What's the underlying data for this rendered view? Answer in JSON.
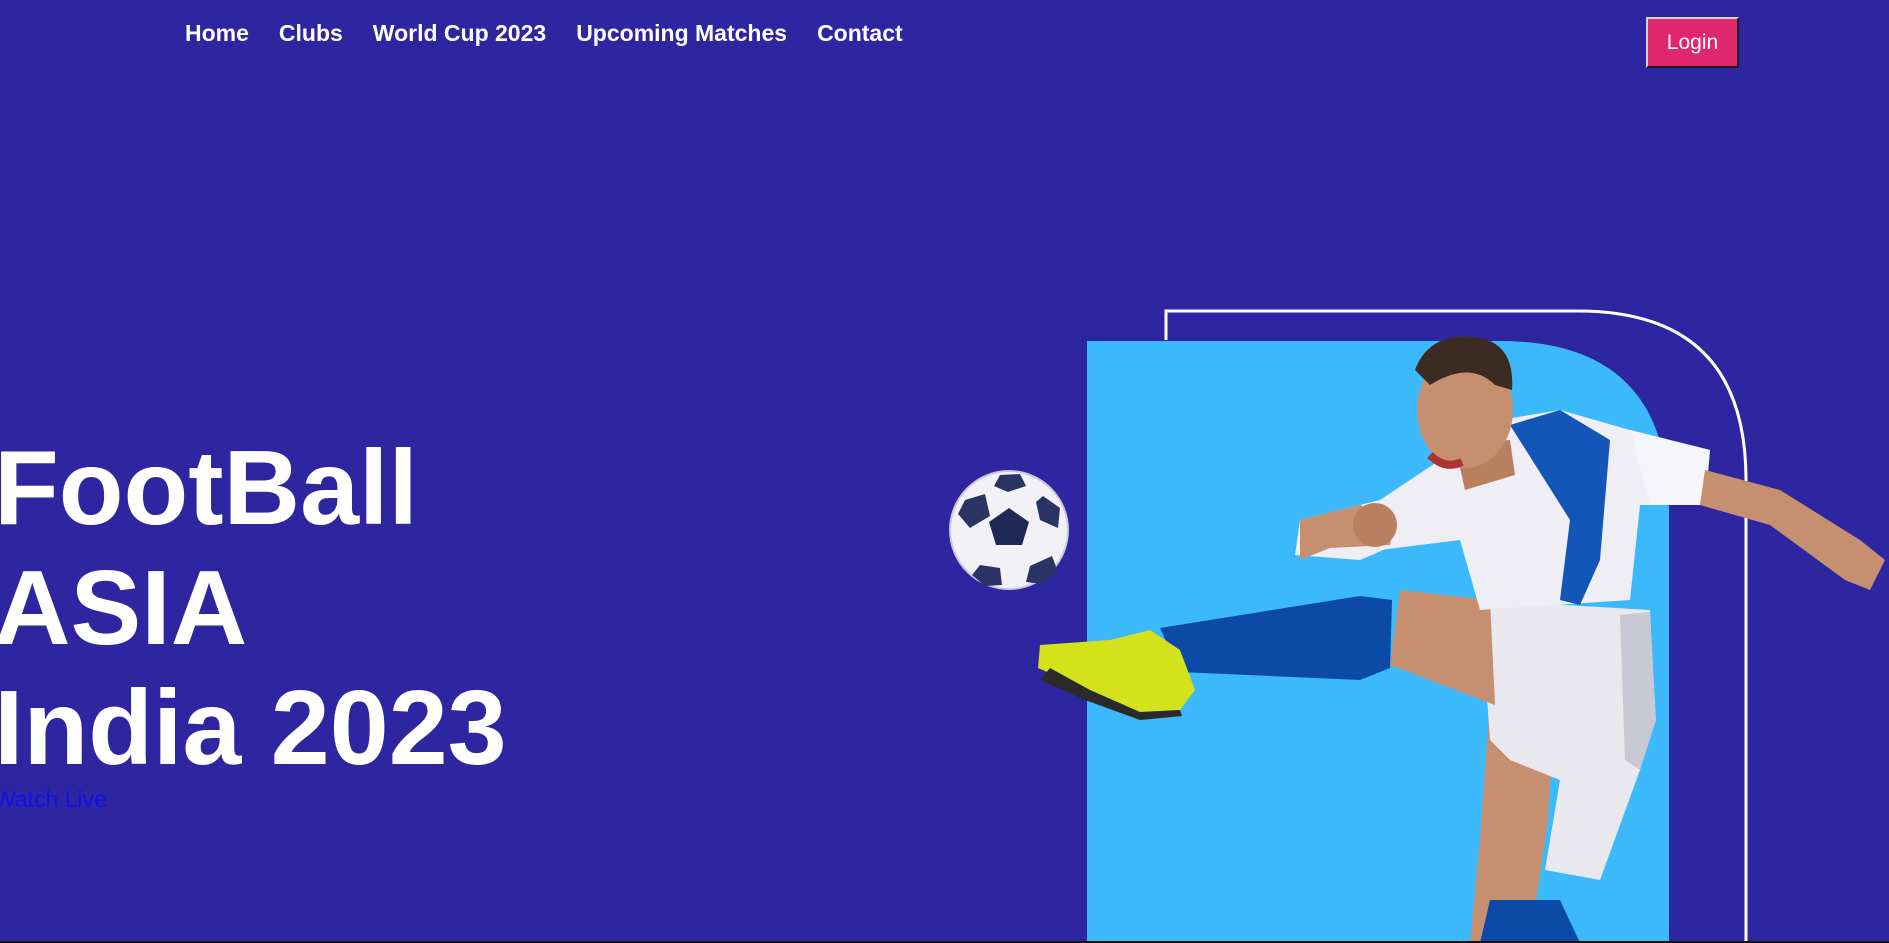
{
  "nav": {
    "items": [
      {
        "label": "Home"
      },
      {
        "label": "Clubs"
      },
      {
        "label": "World Cup 2023"
      },
      {
        "label": "Upcoming Matches"
      },
      {
        "label": "Contact"
      }
    ]
  },
  "login": {
    "label": "Login"
  },
  "hero": {
    "title_lines": [
      "FootBall",
      "ASIA",
      "India 2023"
    ],
    "watch_label": "Watch Live"
  },
  "colors": {
    "background": "#2e26a0",
    "accent_panel": "#3bb9fb",
    "login_button": "#e0276d",
    "link": "#1010ee"
  },
  "illustration": {
    "icon": "soccer-player-kicking-ball"
  }
}
